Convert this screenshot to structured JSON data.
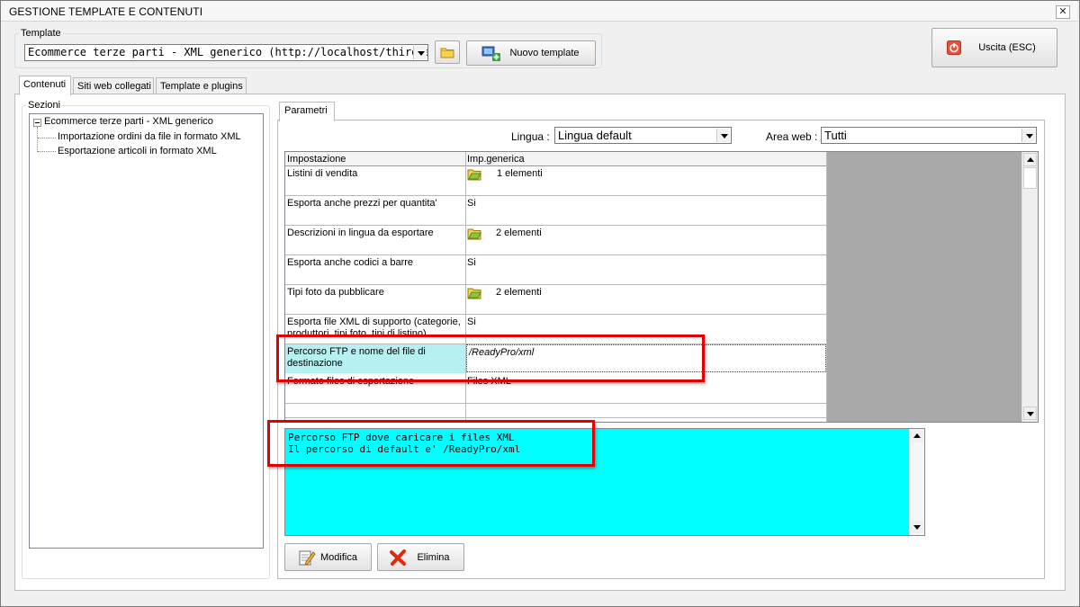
{
  "window": {
    "title": "GESTIONE TEMPLATE E CONTENUTI",
    "close_glyph": "✕"
  },
  "template": {
    "group_label": "Template",
    "selected": "Ecommerce terze parti - XML generico (http://localhost/thirdnew)",
    "new_button": "Nuovo template",
    "folder_icon": "folder-icon"
  },
  "exit_button": "Uscita (ESC)",
  "tabs": [
    {
      "label": "Contenuti",
      "active": true
    },
    {
      "label": "Siti web collegati",
      "active": false
    },
    {
      "label": "Template e plugins",
      "active": false
    }
  ],
  "sections": {
    "label": "Sezioni",
    "tree": {
      "root": "Ecommerce terze parti - XML generico",
      "children": [
        "Importazione ordini da file in formato XML",
        "Esportazione articoli in formato XML"
      ]
    }
  },
  "parameters": {
    "tab": "Parametri",
    "lingua_label": "Lingua :",
    "lingua_value": "Lingua default",
    "area_label": "Area web :",
    "area_value": "Tutti",
    "columns": [
      "Impostazione",
      "Imp.generica"
    ],
    "rows": [
      {
        "name": "Listini di vendita",
        "value": "1 elementi",
        "icon": "folder-icon"
      },
      {
        "name": "Esporta anche prezzi per quantita'",
        "value": "Si"
      },
      {
        "name": "Descrizioni in lingua da esportare",
        "value": "2 elementi",
        "icon": "folder-icon"
      },
      {
        "name": "Esporta anche codici a barre",
        "value": "Si"
      },
      {
        "name": "Tipi foto da pubblicare",
        "value": "2 elementi",
        "icon": "folder-icon"
      },
      {
        "name": "Esporta file XML di supporto (categorie, produttori, tipi foto, tipi di listino)",
        "value": "Si"
      },
      {
        "name": "Percorso FTP e nome del file di destinazione",
        "value": "/ReadyPro/xml",
        "selected": true
      },
      {
        "name": "Formato files di esportazione",
        "value": "Files XML"
      }
    ],
    "description": [
      "Percorso FTP dove caricare i files XML",
      "Il percorso di default e' /ReadyPro/xml"
    ]
  },
  "buttons": {
    "modifica": "Modifica",
    "elimina": "Elimina"
  },
  "colors": {
    "highlight": "#00ffff",
    "selected_cell": "#b7f0f0",
    "annotation": "#e30000"
  }
}
